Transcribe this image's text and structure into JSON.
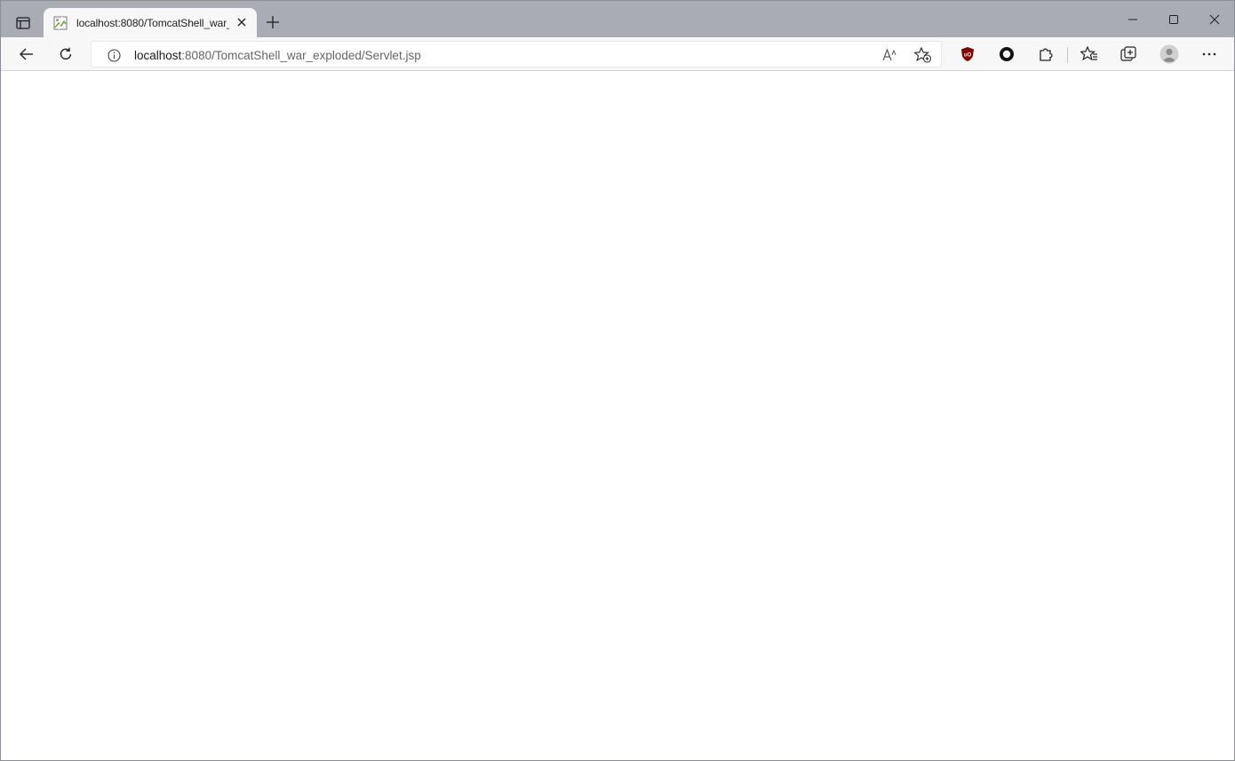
{
  "tab": {
    "title": "localhost:8080/TomcatShell_war_",
    "favicon": "broken-image-icon"
  },
  "address": {
    "host": "localhost",
    "path": ":8080/TomcatShell_war_exploded/Servlet.jsp"
  },
  "toolbar_icons": {
    "back": "back-arrow-icon",
    "refresh": "refresh-icon",
    "read_aloud": "read-aloud-icon",
    "add_favorite": "add-favorite-icon",
    "extension_ublock": "ublock-origin-icon",
    "extension_circle": "circle-extension-icon",
    "extensions": "extensions-puzzle-icon",
    "favorites": "favorites-icon",
    "collections": "collections-icon",
    "profile": "profile-avatar-icon",
    "more": "more-menu-icon"
  },
  "colors": {
    "titlebar": "#a9adb3",
    "toolbar": "#f7f7f7",
    "ublock_red": "#800000"
  }
}
